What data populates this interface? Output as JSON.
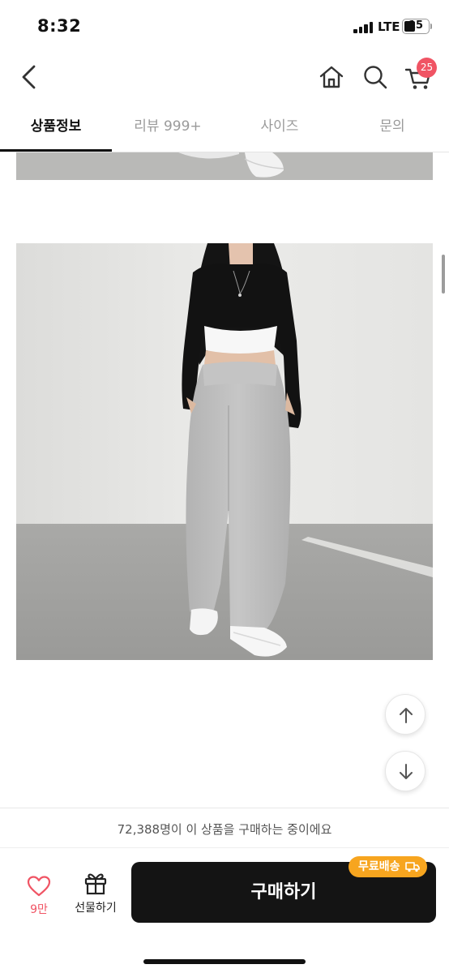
{
  "status_bar": {
    "time": "8:32",
    "network": "LTE",
    "battery": "15"
  },
  "header": {
    "cart_count": "25",
    "icons": [
      "chevron-left-icon",
      "home-icon",
      "search-icon",
      "cart-icon"
    ]
  },
  "tabs": [
    {
      "label": "상품정보",
      "active": true
    },
    {
      "label": "리뷰 999+",
      "active": false
    },
    {
      "label": "사이즈",
      "active": false
    },
    {
      "label": "문의",
      "active": false
    }
  ],
  "purchase": {
    "buyers_text": "72,388명이 이 상품을 구매하는 중이에요",
    "like_count": "9만",
    "gift_label": "선물하기",
    "buy_label": "구매하기",
    "shipping_badge": "무료배송"
  },
  "colors": {
    "accent": "#f05464",
    "buy_button": "#141414",
    "shipping_badge": "#f7a51f"
  }
}
